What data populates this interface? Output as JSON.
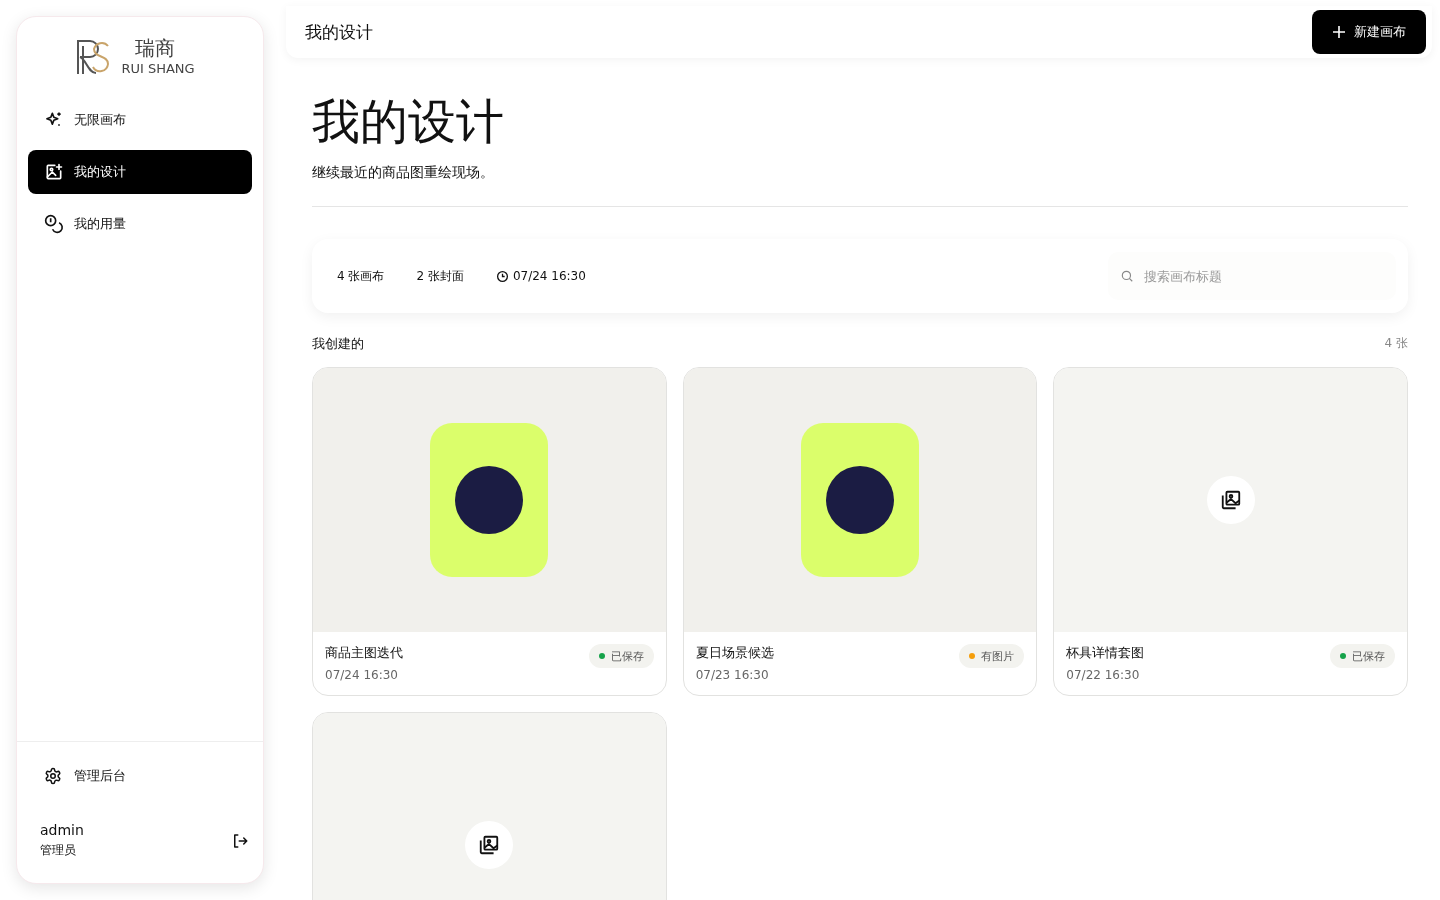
{
  "brand": {
    "name": "瑞商",
    "subtitle": "RUI SHANG"
  },
  "sidebar": {
    "items": [
      {
        "label": "无限画布",
        "selected": false
      },
      {
        "label": "我的设计",
        "selected": true
      },
      {
        "label": "我的用量",
        "selected": false
      }
    ],
    "footer_item": {
      "label": "管理后台"
    },
    "user": {
      "name": "admin",
      "role": "管理员"
    }
  },
  "topbar": {
    "title": "我的设计",
    "new_button": "新建画布"
  },
  "header": {
    "title": "我的设计",
    "subtitle": "继续最近的商品图重绘现场。"
  },
  "stats": {
    "items": [
      "4 张画布",
      "2 张封面"
    ],
    "updated": "07/24 16:30",
    "search_placeholder": "搜索画布标题"
  },
  "section": {
    "title": "我创建的",
    "count": "4 张"
  },
  "cards": [
    {
      "kind": "cover",
      "title": "商品主图迭代",
      "date": "07/24 16:30",
      "status": "已保存",
      "color": "#16a34a"
    },
    {
      "kind": "cover",
      "title": "夏日场景候选",
      "date": "07/23 16:30",
      "status": "有图片",
      "color": "#f59e0b"
    },
    {
      "kind": "empty",
      "title": "杯具详情套图",
      "date": "07/22 16:30",
      "status": "已保存",
      "color": "#16a34a"
    },
    {
      "kind": "empty"
    }
  ]
}
